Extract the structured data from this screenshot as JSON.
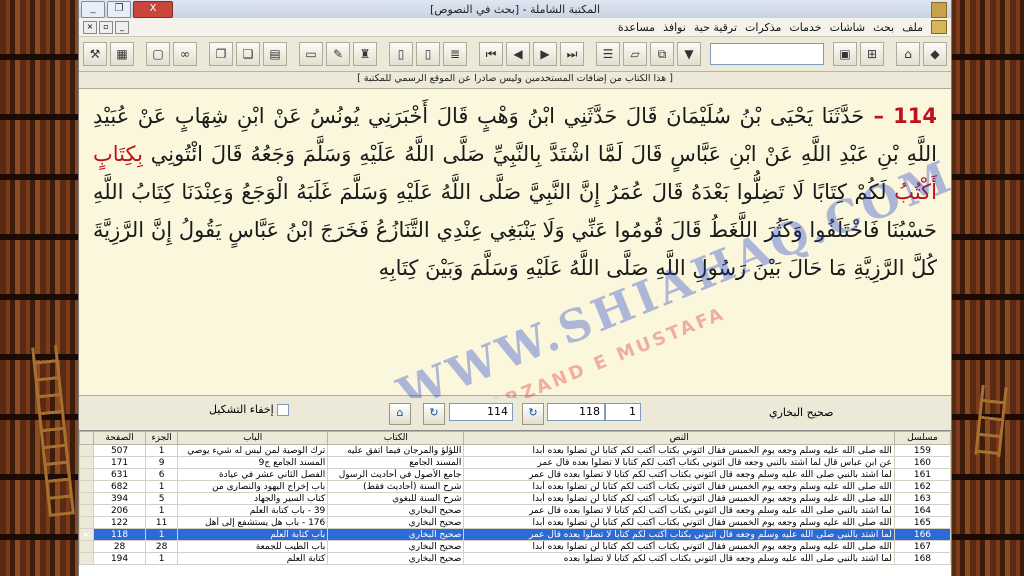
{
  "window": {
    "title": "المكتبة الشاملة - [بحث في النصوص]",
    "minimize": "_",
    "restore": "❐",
    "close": "X"
  },
  "menu": [
    "ملف",
    "بحث",
    "شاشات",
    "خدمات",
    "مذكرات",
    "ترقية حية",
    "نوافذ",
    "مساعدة"
  ],
  "notice": "[ هذا الكتاب من إضافات المستخدمين وليس صادرا عن الموقع الرسمي للمكتبة ]",
  "hadith": {
    "number": "114",
    "dash": " – ",
    "part1": "حَدَّثَنَا يَحْيَى بْنُ سُلَيْمَانَ قَالَ حَدَّثَنِي ابْنُ وَهْبٍ قَالَ أَخْبَرَنِي يُونُسُ عَنْ ابْنِ شِهَابٍ عَنْ عُبَيْدِ اللَّهِ بْنِ عَبْدِ اللَّهِ عَنْ ابْنِ عَبَّاسٍ قَالَ لَمَّا اشْتَدَّ بِالنَّبِيِّ صَلَّى اللَّهُ عَلَيْهِ وَسَلَّمَ وَجَعُهُ قَالَ ائْتُونِي ",
    "highlight": "بِكِتَابٍ أَكْتُبُ",
    "part2": " لَكُمْ كِتَابًا لَا تَضِلُّوا بَعْدَهُ قَالَ عُمَرُ إِنَّ النَّبِيَّ صَلَّى اللَّهُ عَلَيْهِ وَسَلَّمَ غَلَبَهُ الْوَجَعُ وَعِنْدَنَا كِتَابُ اللَّهِ حَسْبُنَا فَاخْتَلَفُوا وَكَثُرَ اللَّغَطُ قَالَ قُومُوا عَنِّي وَلَا يَنْبَغِي عِنْدِي التَّنَازُعُ فَخَرَجَ ابْنُ عَبَّاسٍ يَقُولُ إِنَّ الرَّزِيَّةَ كُلَّ الرَّزِيَّةِ مَا حَالَ بَيْنَ رَسُولِ اللَّهِ صَلَّى اللَّهُ عَلَيْهِ وَسَلَّمَ وَبَيْنَ كِتَابِهِ"
  },
  "watermark": {
    "main": "WWW.SHIAHAQ.COM",
    "sub": "FARZAND E MUSTAFA"
  },
  "controls": {
    "book_label": "صحيح البخاري",
    "part_value": "1",
    "page_value": "118",
    "hadith_value": "114",
    "hide_diacritics": "إخفاء التشكيل"
  },
  "table": {
    "headers": [
      "مسلسل",
      "النص",
      "الكتاب",
      "الباب",
      "الجزء",
      "الصفحة"
    ],
    "rows": [
      [
        "159",
        "الله صلى الله عليه وسلم وجعه يوم الخميس فقال ائتوني بكتاب أكتب لكم كتابا لن تضلوا بعده أبدا",
        "اللؤلؤ والمرجان فيما اتفق عليه",
        "ترك الوصية لمن ليس له شيء يوصي",
        "1",
        "507"
      ],
      [
        "160",
        "عن ابن عباس قال لما اشتد بالنبي وجعه قال ائتوني بكتاب أكتب لكم كتابا لا تضلوا بعده قال عمر",
        "المسند الجامع",
        "المسند الجامع ج9",
        "9",
        "171"
      ],
      [
        "161",
        "لما اشتد بالنبي صلى الله عليه وسلم وجعه قال ائتوني بكتاب أكتب لكم كتابا لا تضلوا بعده قال عمر",
        "جامع الأصول في أحاديث الرسول",
        "الفصل الثاني عشر في عيادة",
        "6",
        "631"
      ],
      [
        "162",
        "الله صلى الله عليه وسلم وجعه يوم الخميس فقال ائتوني بكتاب أكتب لكم كتابا لن تضلوا بعده أبدا",
        "شرح السنة (أحاديث فقط)",
        "باب إخراج اليهود والنصارى من",
        "1",
        "682"
      ],
      [
        "163",
        "الله صلى الله عليه وسلم وجعه يوم الخميس فقال ائتوني بكتاب أكتب لكم كتابا لن تضلوا بعده أبدا",
        "شرح السنة للبغوي",
        "كتاب السير والجهاد",
        "5",
        "394"
      ],
      [
        "164",
        "لما اشتد بالنبي صلى الله عليه وسلم وجعه قال ائتوني بكتاب أكتب لكم كتابا لا تضلوا بعده قال عمر",
        "صحيح البخاري",
        "39 - باب كتابة العلم",
        "1",
        "206"
      ],
      [
        "165",
        "الله صلى الله عليه وسلم وجعه يوم الخميس فقال ائتوني بكتاب أكتب لكم كتابا لن تضلوا بعده أبدا",
        "صحيح البخاري",
        "176 - باب هل يستشفع إلى أهل",
        "11",
        "122"
      ],
      [
        "166",
        "لما اشتد بالنبي صلى الله عليه وسلم وجعه قال ائتوني بكتاب أكتب لكم كتابا لا تضلوا بعده قال عمر",
        "صحيح البخاري",
        "باب كتابة العلم",
        "1",
        "118"
      ],
      [
        "167",
        "الله صلى الله عليه وسلم وجعه يوم الخميس فقال ائتوني بكتاب أكتب لكم كتابا لن تضلوا بعده أبدا",
        "صحيح البخاري",
        "باب الطيب للجمعة",
        "28",
        "28"
      ],
      [
        "168",
        "لما اشتد بالنبي صلى الله عليه وسلم وجعه قال ائتوني بكتاب أكتب لكم كتابا لا تضلوا بعده",
        "صحيح البخاري",
        "كتابة العلم",
        "1",
        "194"
      ]
    ],
    "selected_index": 7
  },
  "colors": {
    "hadith_number": "#c0101a",
    "selection": "#2c6bd6",
    "text_pane": "#faf7dd"
  }
}
